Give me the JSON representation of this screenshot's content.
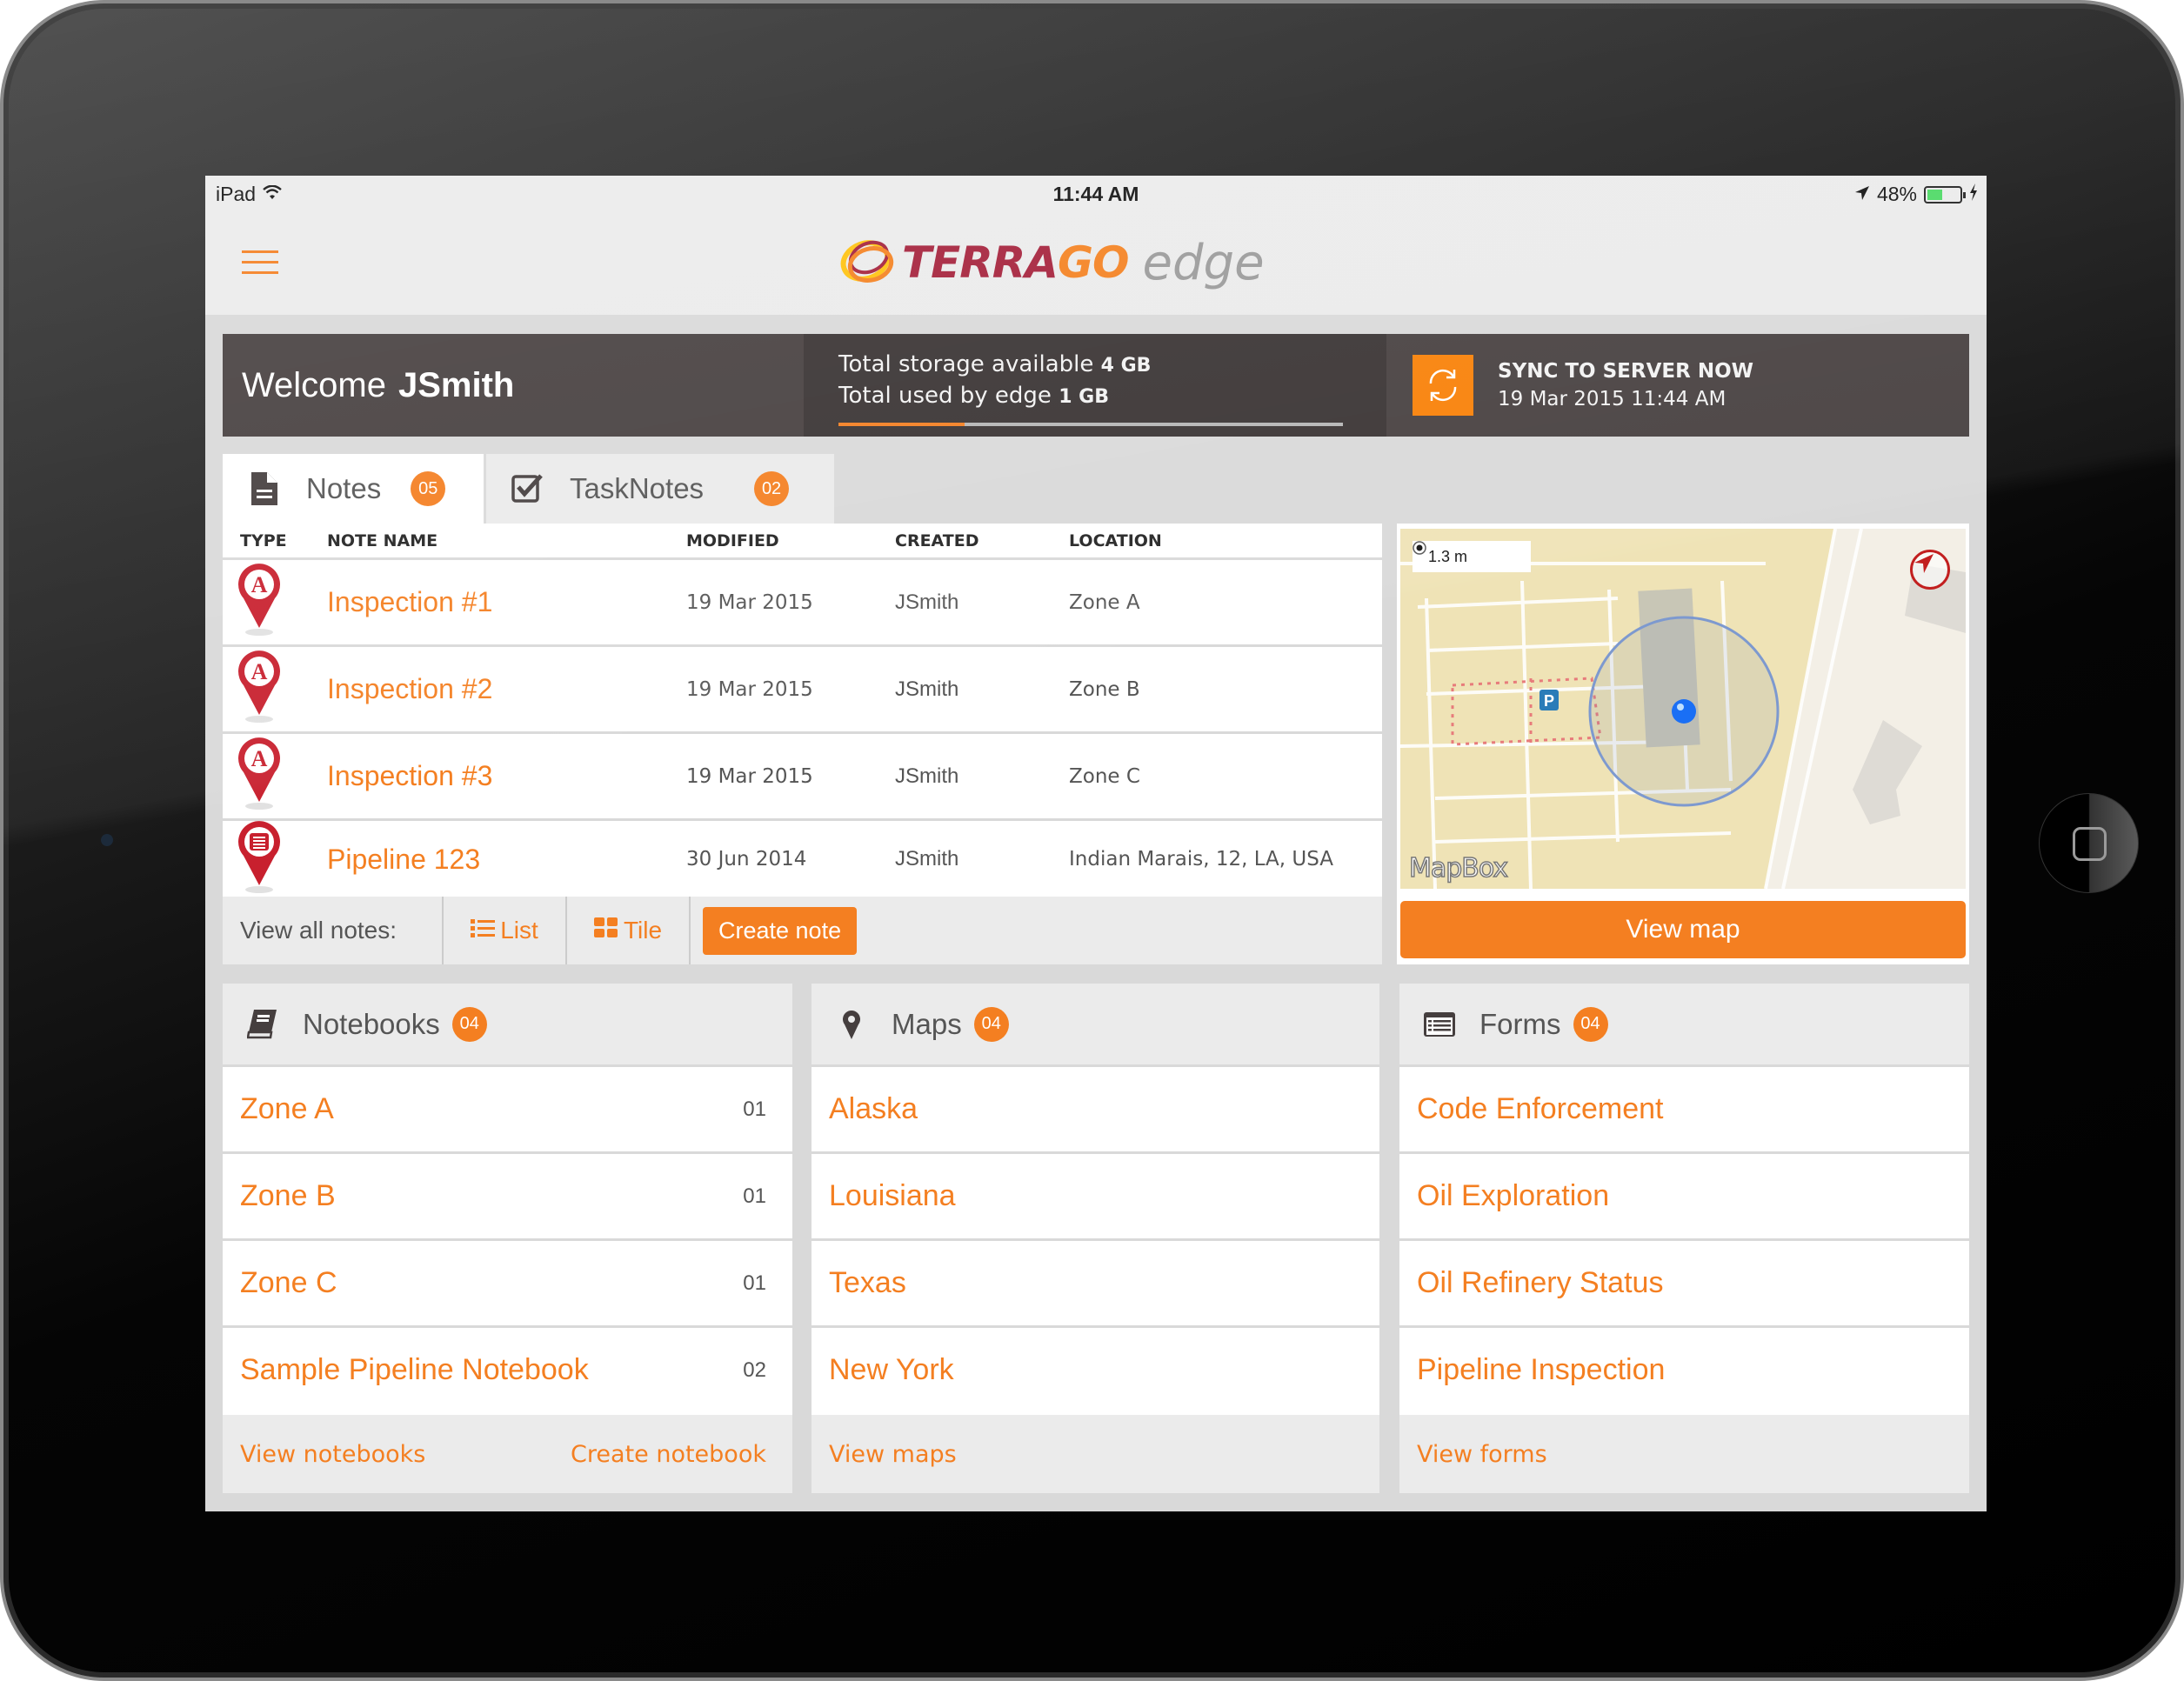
{
  "status_bar": {
    "device": "iPad",
    "time": "11:44 AM",
    "battery": "48%",
    "battery_level": 0.48
  },
  "header": {
    "logo_terra": "TERRA",
    "logo_go": "GO",
    "logo_edge": "edge",
    "menu_icon": "hamburger-icon"
  },
  "banner": {
    "welcome_label": "Welcome",
    "username": "JSmith",
    "storage_available_label": "Total storage available",
    "storage_available_value": "4 GB",
    "storage_used_label": "Total used by edge",
    "storage_used_value": "1 GB",
    "storage_used_fraction": 0.25,
    "sync_title": "SYNC TO SERVER NOW",
    "sync_date": "19 Mar 2015 11:44 AM"
  },
  "tabs": [
    {
      "label": "Notes",
      "count": "05",
      "icon": "document-icon",
      "active": true
    },
    {
      "label": "TaskNotes",
      "count": "02",
      "icon": "checkbox-icon",
      "active": false
    }
  ],
  "notes_table": {
    "columns": [
      "TYPE",
      "NOTE NAME",
      "MODIFIED",
      "CREATED",
      "LOCATION"
    ],
    "rows": [
      {
        "type": "annotation-pin",
        "name": "Inspection #1",
        "modified": "19 Mar 2015",
        "created": "JSmith",
        "location": "Zone A"
      },
      {
        "type": "annotation-pin",
        "name": "Inspection #2",
        "modified": "19 Mar 2015",
        "created": "JSmith",
        "location": "Zone B"
      },
      {
        "type": "annotation-pin",
        "name": "Inspection #3",
        "modified": "19 Mar 2015",
        "created": "JSmith",
        "location": "Zone C"
      },
      {
        "type": "form-pin",
        "name": "Pipeline 123",
        "modified": "30 Jun 2014",
        "created": "JSmith",
        "location": "Indian Marais, 12, LA, USA"
      }
    ],
    "footer": {
      "view_all_label": "View all notes:",
      "list_label": "List",
      "tile_label": "Tile",
      "create_label": "Create note"
    }
  },
  "map": {
    "scale_label": "1.3 m",
    "attribution": "MapBox",
    "parking_label": "P",
    "view_map_label": "View map"
  },
  "cards": {
    "notebooks": {
      "title": "Notebooks",
      "count": "04",
      "items": [
        {
          "name": "Zone A",
          "count": "01"
        },
        {
          "name": "Zone B",
          "count": "01"
        },
        {
          "name": "Zone C",
          "count": "01"
        },
        {
          "name": "Sample Pipeline Notebook",
          "count": "02"
        }
      ],
      "view_link": "View notebooks",
      "create_link": "Create notebook"
    },
    "maps": {
      "title": "Maps",
      "count": "04",
      "items": [
        {
          "name": "Alaska"
        },
        {
          "name": "Louisiana"
        },
        {
          "name": "Texas"
        },
        {
          "name": "New York"
        }
      ],
      "view_link": "View maps"
    },
    "forms": {
      "title": "Forms",
      "count": "04",
      "items": [
        {
          "name": "Code Enforcement"
        },
        {
          "name": "Oil Exploration"
        },
        {
          "name": "Oil Refinery Status"
        },
        {
          "name": "Pipeline Inspection"
        }
      ],
      "view_link": "View forms"
    }
  },
  "colors": {
    "accent": "#f47f21",
    "banner_dark": "#463f3f",
    "banner_darker": "#383232",
    "pin_red": "#c8202e",
    "brand_red": "#a4203a"
  }
}
